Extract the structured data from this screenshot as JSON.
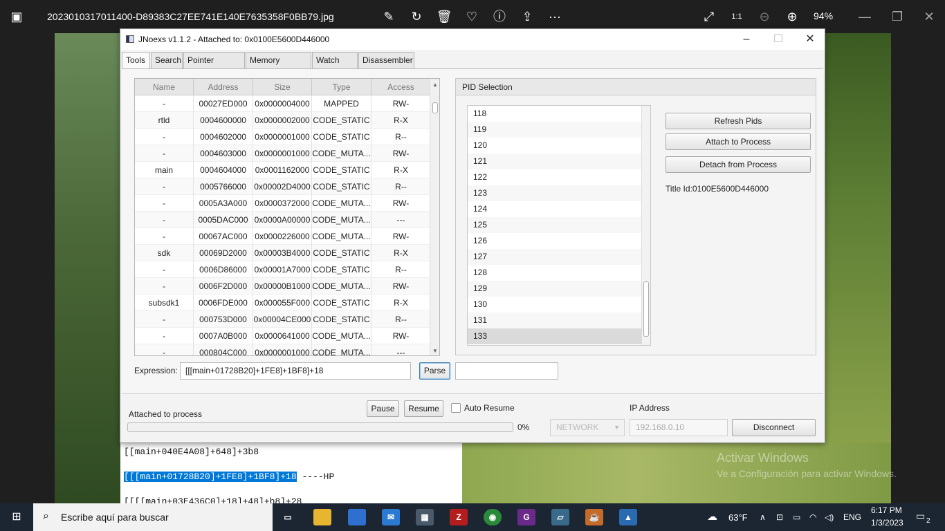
{
  "photos_bar": {
    "file_name": "2023010317011400-D89383C27EE741E140E7635358F0BB79.jpg",
    "zoom": "94%",
    "icons": [
      "photos-icon",
      "edit-icon",
      "rotate-icon",
      "delete-icon",
      "heart-icon",
      "info-icon",
      "share-icon",
      "more-icon",
      "expand-icon",
      "actual-size-icon",
      "zoom-out-icon",
      "zoom-in-icon",
      "minimize-icon",
      "restore-icon",
      "close-icon"
    ]
  },
  "window": {
    "title": "JNoexs v1.1.2 - Attached to: 0x0100E5600D446000",
    "tabs": [
      "Tools",
      "Search",
      "Pointer Search",
      "Memory Viewer",
      "Watch List",
      "Disassembler"
    ],
    "active_tab": "Tools"
  },
  "memory_table": {
    "columns": [
      "Name",
      "Address",
      "Size",
      "Type",
      "Access"
    ],
    "rows": [
      [
        "-",
        "00027ED000",
        "0x0000004000",
        "MAPPED",
        "RW-"
      ],
      [
        "rtld",
        "0004600000",
        "0x0000002000",
        "CODE_STATIC",
        "R-X"
      ],
      [
        "-",
        "0004602000",
        "0x0000001000",
        "CODE_STATIC",
        "R--"
      ],
      [
        "-",
        "0004603000",
        "0x0000001000",
        "CODE_MUTA...",
        "RW-"
      ],
      [
        "main",
        "0004604000",
        "0x0001162000",
        "CODE_STATIC",
        "R-X"
      ],
      [
        "-",
        "0005766000",
        "0x00002D4000",
        "CODE_STATIC",
        "R--"
      ],
      [
        "-",
        "0005A3A000",
        "0x0000372000",
        "CODE_MUTA...",
        "RW-"
      ],
      [
        "-",
        "0005DAC000",
        "0x0000A00000",
        "CODE_MUTA...",
        "---"
      ],
      [
        "-",
        "00067AC000",
        "0x0000226000",
        "CODE_MUTA...",
        "RW-"
      ],
      [
        "sdk",
        "00069D2000",
        "0x00003B4000",
        "CODE_STATIC",
        "R-X"
      ],
      [
        "-",
        "0006D86000",
        "0x00001A7000",
        "CODE_STATIC",
        "R--"
      ],
      [
        "-",
        "0006F2D000",
        "0x00000B1000",
        "CODE_MUTA...",
        "RW-"
      ],
      [
        "subsdk1",
        "0006FDE000",
        "0x000055F000",
        "CODE_STATIC",
        "R-X"
      ],
      [
        "-",
        "000753D000",
        "0x00004CE000",
        "CODE_STATIC",
        "R--"
      ],
      [
        "-",
        "0007A0B000",
        "0x0000641000",
        "CODE_MUTA...",
        "RW-"
      ],
      [
        "-",
        "000804C000",
        "0x0000001000",
        "CODE_MUTA...",
        "---"
      ]
    ]
  },
  "pid_selection": {
    "title": "PID Selection",
    "pids": [
      "118",
      "119",
      "120",
      "121",
      "122",
      "123",
      "124",
      "125",
      "126",
      "127",
      "128",
      "129",
      "130",
      "131",
      "133"
    ],
    "selected": "133",
    "refresh_label": "Refresh Pids",
    "attach_label": "Attach to Process",
    "detach_label": "Detach from Process",
    "title_id": "Title Id:0100E5600D446000"
  },
  "expression": {
    "label": "Expression:",
    "value": "[[[main+01728B20]+1FE8]+1BF8]+18",
    "parse_label": "Parse",
    "result": ""
  },
  "bottom": {
    "status": "Attached to process",
    "progress_percent": "0%",
    "progress": 0,
    "pause_label": "Pause",
    "resume_label": "Resume",
    "auto_resume_label": "Auto Resume",
    "auto_resume_checked": false,
    "ip_label": "IP Address",
    "network_value": "NETWORK",
    "ip_placeholder": "192.168.0.10",
    "disconnect_label": "Disconnect"
  },
  "notepad": {
    "line1": "[[main+040E4A08]+648]+3b8",
    "line2_selected": "[[[main+01728B20]+1FE8]+1BF8]+18",
    "line2_suffix": " ----HP",
    "line3": "[[[[main+03E436C0]+18]+48]+b8]+28"
  },
  "watermark": {
    "line1": "Activar Windows",
    "line2": "Ve a Configuración para activar Windows."
  },
  "taskbar": {
    "search_placeholder": "Escribe aquí para buscar",
    "temperature": "63°F",
    "language": "ENG",
    "time": "6:17 PM",
    "date": "1/3/2023",
    "notifications": "2"
  }
}
